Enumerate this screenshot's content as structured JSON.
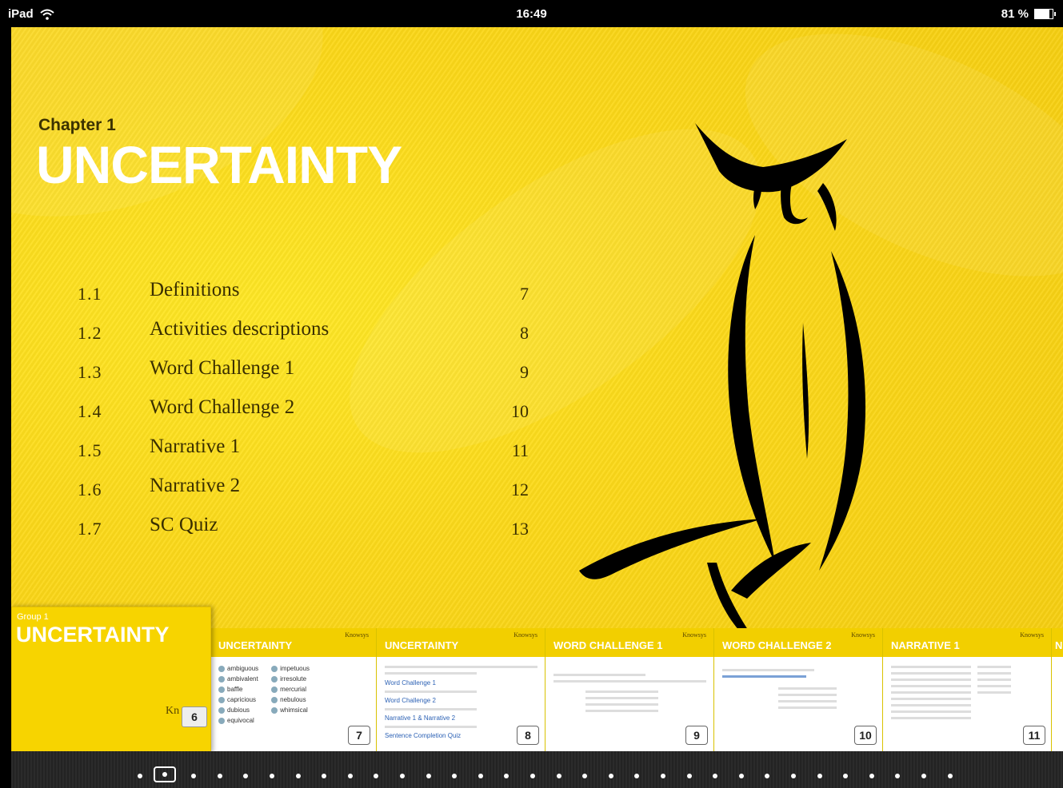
{
  "status_bar": {
    "device": "iPad",
    "time": "16:49",
    "battery": "81 %",
    "battery_level": 0.81
  },
  "chapter": {
    "label": "Chapter 1",
    "title": "UNCERTAINTY"
  },
  "toc": [
    {
      "num": "1.1",
      "title": "Definitions",
      "page": "7"
    },
    {
      "num": "1.2",
      "title": "Activities descriptions",
      "page": "8"
    },
    {
      "num": "1.3",
      "title": "Word Challenge 1",
      "page": "9"
    },
    {
      "num": "1.4",
      "title": "Word Challenge 2",
      "page": "10"
    },
    {
      "num": "1.5",
      "title": "Narrative 1",
      "page": "11"
    },
    {
      "num": "1.6",
      "title": "Narrative 2",
      "page": "12"
    },
    {
      "num": "1.7",
      "title": "SC Quiz",
      "page": "13"
    }
  ],
  "current_thumb": {
    "group": "Group 1",
    "title": "UNCERTAINTY",
    "logo": "Kn",
    "page": "6"
  },
  "thumbs": [
    {
      "title": "UNCERTAINTY",
      "page": "7",
      "words_col1": [
        "ambiguous",
        "ambivalent",
        "baffle",
        "capricious",
        "dubious",
        "equivocal"
      ],
      "words_col2": [
        "impetuous",
        "irresolute",
        "mercurial",
        "nebulous",
        "whimsical"
      ]
    },
    {
      "title": "UNCERTAINTY",
      "page": "8",
      "links": [
        "Word Challenge 1",
        "Word Challenge 2",
        "Narrative 1 & Narrative 2",
        "Sentence Completion Quiz"
      ]
    },
    {
      "title": "WORD CHALLENGE 1",
      "page": "9"
    },
    {
      "title": "WORD CHALLENGE 2",
      "page": "10"
    },
    {
      "title": "NARRATIVE 1",
      "page": "11"
    },
    {
      "title": "N",
      "page": ""
    }
  ],
  "thumb_logo": "Knowsys",
  "pager": {
    "total_dots": 32,
    "current_index": 1
  },
  "colors": {
    "accent": "#f5cc10",
    "text_dark": "#3a2f00"
  }
}
